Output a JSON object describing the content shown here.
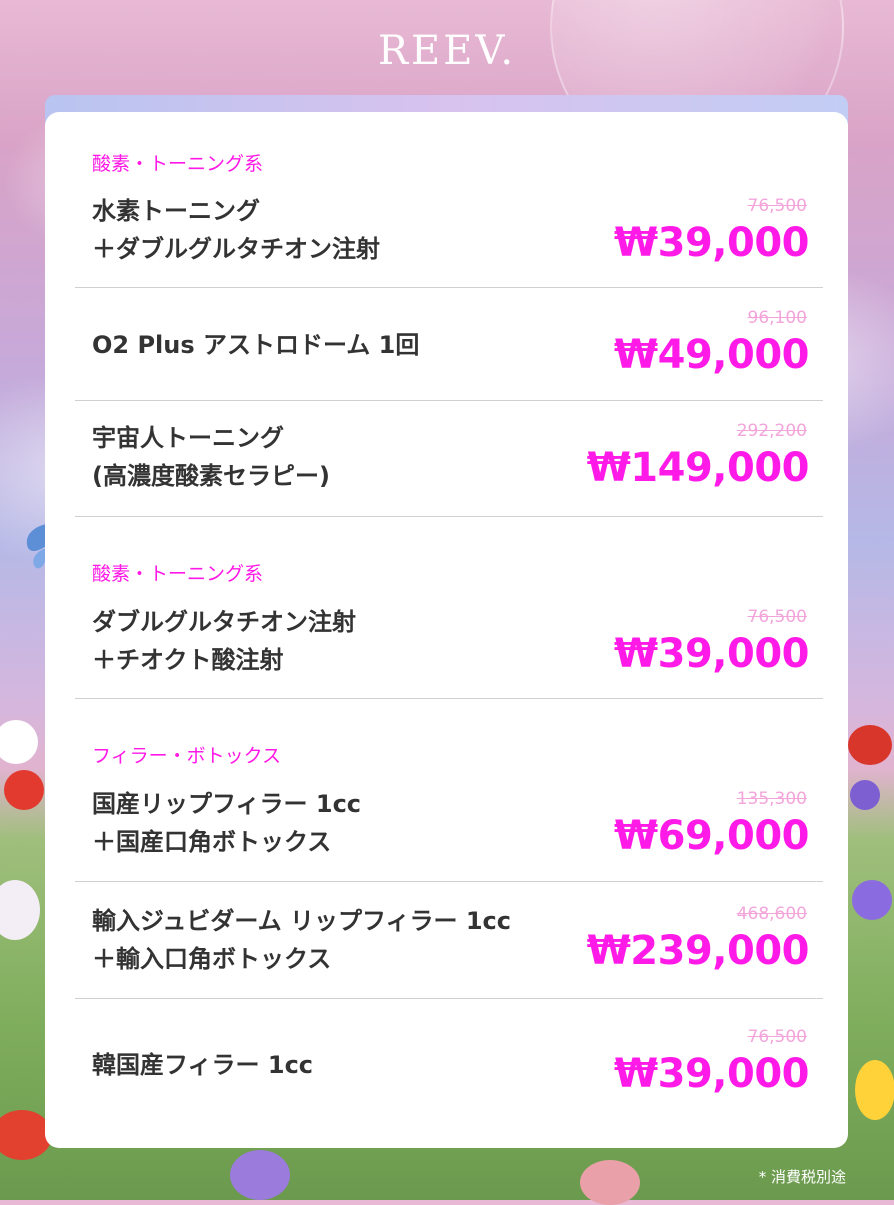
{
  "brand": "REEV.",
  "sections": [
    {
      "category": "酸素・トーニング系",
      "items": [
        {
          "name_lines": [
            "水素トーニング",
            "＋ダブルグルタチオン注射"
          ],
          "old_price": "76,500",
          "price": "₩39,000"
        },
        {
          "name_lines": [
            "O2 Plus アストロドーム 1回"
          ],
          "old_price": "96,100",
          "price": "₩49,000"
        },
        {
          "name_lines": [
            "宇宙人トーニング",
            "(高濃度酸素セラピー)"
          ],
          "old_price": "292,200",
          "price": "₩149,000"
        }
      ]
    },
    {
      "category": "酸素・トーニング系",
      "items": [
        {
          "name_lines": [
            "ダブルグルタチオン注射",
            "＋チオクト酸注射"
          ],
          "old_price": "76,500",
          "price": "₩39,000"
        }
      ]
    },
    {
      "category": "フィラー・ボトックス",
      "items": [
        {
          "name_lines": [
            "国産リップフィラー 1cc",
            "＋国産口角ボトックス"
          ],
          "old_price": "135,300",
          "price": "₩69,000"
        },
        {
          "name_lines": [
            "輸入ジュビダーム リップフィラー 1cc",
            "＋輸入口角ボトックス"
          ],
          "old_price": "468,600",
          "price": "₩239,000"
        },
        {
          "name_lines": [
            "韓国産フィラー 1cc"
          ],
          "old_price": "76,500",
          "price": "₩39,000"
        }
      ]
    }
  ],
  "footnote": "* 消費税別途",
  "colors": {
    "accent": "#ff18e6",
    "old_price": "#f3a5db",
    "text": "#333333"
  }
}
